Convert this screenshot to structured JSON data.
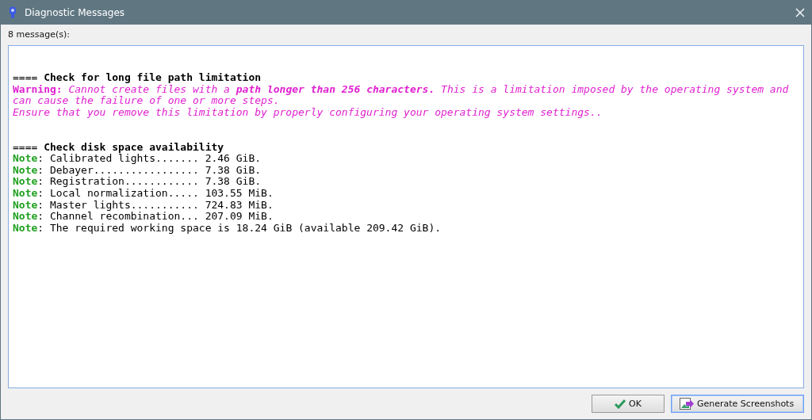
{
  "window": {
    "title": "Diagnostic Messages"
  },
  "count_label": "8 message(s):",
  "log": [
    {
      "kind": "heading",
      "text": "==== **Check for long file path limitation**"
    },
    {
      "kind": "warning",
      "label": "Warning:",
      "text": "Cannot create files with a **path longer than 256 characters.** This is a limitation imposed by the operating system and\ncan cause the failure of one or more steps."
    },
    {
      "kind": "warning",
      "text": "Ensure that you remove this limitation by properly configuring your operating system settings.."
    },
    {
      "kind": "blank"
    },
    {
      "kind": "blank"
    },
    {
      "kind": "heading",
      "text": "==== **Check disk space availability**"
    },
    {
      "kind": "note",
      "label": "Note",
      "text": ": Calibrated lights....... 2.46 GiB."
    },
    {
      "kind": "note",
      "label": "Note",
      "text": ": Debayer................. 7.38 GiB."
    },
    {
      "kind": "note",
      "label": "Note",
      "text": ": Registration............ 7.38 GiB."
    },
    {
      "kind": "note",
      "label": "Note",
      "text": ": Local normalization..... 103.55 MiB."
    },
    {
      "kind": "note",
      "label": "Note",
      "text": ": Master lights........... 724.83 MiB."
    },
    {
      "kind": "note",
      "label": "Note",
      "text": ": Channel recombination... 207.09 MiB."
    },
    {
      "kind": "note",
      "label": "Note",
      "text": ": The required working space is 18.24 GiB (available 209.42 GiB)."
    }
  ],
  "buttons": [
    {
      "kind": "ok",
      "label": "OK",
      "selected": false
    },
    {
      "kind": "screenshots",
      "label": "Generate Screenshots",
      "selected": true
    }
  ]
}
